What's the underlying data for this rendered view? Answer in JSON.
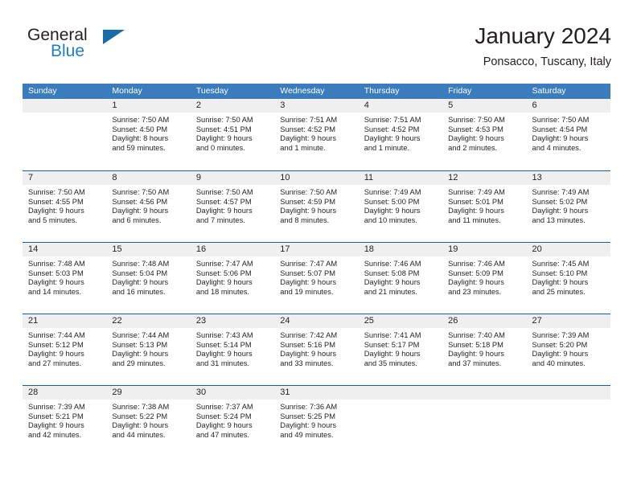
{
  "brand": {
    "word_one": "General",
    "word_two": "Blue",
    "logo_icon": "triangle-icon"
  },
  "header": {
    "title": "January 2024",
    "subtitle": "Ponsacco, Tuscany, Italy"
  },
  "colors": {
    "header_blue": "#3a7cbe",
    "row_divider_blue": "#1a5e9e",
    "day_band_gray": "#efefef",
    "brand_blue": "#1d7fc3",
    "text": "#231f20"
  },
  "weekdays": [
    "Sunday",
    "Monday",
    "Tuesday",
    "Wednesday",
    "Thursday",
    "Friday",
    "Saturday"
  ],
  "weeks": [
    [
      {
        "day": "",
        "lines": []
      },
      {
        "day": "1",
        "lines": [
          "Sunrise: 7:50 AM",
          "Sunset: 4:50 PM",
          "Daylight: 8 hours",
          "and 59 minutes."
        ]
      },
      {
        "day": "2",
        "lines": [
          "Sunrise: 7:50 AM",
          "Sunset: 4:51 PM",
          "Daylight: 9 hours",
          "and 0 minutes."
        ]
      },
      {
        "day": "3",
        "lines": [
          "Sunrise: 7:51 AM",
          "Sunset: 4:52 PM",
          "Daylight: 9 hours",
          "and 1 minute."
        ]
      },
      {
        "day": "4",
        "lines": [
          "Sunrise: 7:51 AM",
          "Sunset: 4:52 PM",
          "Daylight: 9 hours",
          "and 1 minute."
        ]
      },
      {
        "day": "5",
        "lines": [
          "Sunrise: 7:50 AM",
          "Sunset: 4:53 PM",
          "Daylight: 9 hours",
          "and 2 minutes."
        ]
      },
      {
        "day": "6",
        "lines": [
          "Sunrise: 7:50 AM",
          "Sunset: 4:54 PM",
          "Daylight: 9 hours",
          "and 4 minutes."
        ]
      }
    ],
    [
      {
        "day": "7",
        "lines": [
          "Sunrise: 7:50 AM",
          "Sunset: 4:55 PM",
          "Daylight: 9 hours",
          "and 5 minutes."
        ]
      },
      {
        "day": "8",
        "lines": [
          "Sunrise: 7:50 AM",
          "Sunset: 4:56 PM",
          "Daylight: 9 hours",
          "and 6 minutes."
        ]
      },
      {
        "day": "9",
        "lines": [
          "Sunrise: 7:50 AM",
          "Sunset: 4:57 PM",
          "Daylight: 9 hours",
          "and 7 minutes."
        ]
      },
      {
        "day": "10",
        "lines": [
          "Sunrise: 7:50 AM",
          "Sunset: 4:59 PM",
          "Daylight: 9 hours",
          "and 8 minutes."
        ]
      },
      {
        "day": "11",
        "lines": [
          "Sunrise: 7:49 AM",
          "Sunset: 5:00 PM",
          "Daylight: 9 hours",
          "and 10 minutes."
        ]
      },
      {
        "day": "12",
        "lines": [
          "Sunrise: 7:49 AM",
          "Sunset: 5:01 PM",
          "Daylight: 9 hours",
          "and 11 minutes."
        ]
      },
      {
        "day": "13",
        "lines": [
          "Sunrise: 7:49 AM",
          "Sunset: 5:02 PM",
          "Daylight: 9 hours",
          "and 13 minutes."
        ]
      }
    ],
    [
      {
        "day": "14",
        "lines": [
          "Sunrise: 7:48 AM",
          "Sunset: 5:03 PM",
          "Daylight: 9 hours",
          "and 14 minutes."
        ]
      },
      {
        "day": "15",
        "lines": [
          "Sunrise: 7:48 AM",
          "Sunset: 5:04 PM",
          "Daylight: 9 hours",
          "and 16 minutes."
        ]
      },
      {
        "day": "16",
        "lines": [
          "Sunrise: 7:47 AM",
          "Sunset: 5:06 PM",
          "Daylight: 9 hours",
          "and 18 minutes."
        ]
      },
      {
        "day": "17",
        "lines": [
          "Sunrise: 7:47 AM",
          "Sunset: 5:07 PM",
          "Daylight: 9 hours",
          "and 19 minutes."
        ]
      },
      {
        "day": "18",
        "lines": [
          "Sunrise: 7:46 AM",
          "Sunset: 5:08 PM",
          "Daylight: 9 hours",
          "and 21 minutes."
        ]
      },
      {
        "day": "19",
        "lines": [
          "Sunrise: 7:46 AM",
          "Sunset: 5:09 PM",
          "Daylight: 9 hours",
          "and 23 minutes."
        ]
      },
      {
        "day": "20",
        "lines": [
          "Sunrise: 7:45 AM",
          "Sunset: 5:10 PM",
          "Daylight: 9 hours",
          "and 25 minutes."
        ]
      }
    ],
    [
      {
        "day": "21",
        "lines": [
          "Sunrise: 7:44 AM",
          "Sunset: 5:12 PM",
          "Daylight: 9 hours",
          "and 27 minutes."
        ]
      },
      {
        "day": "22",
        "lines": [
          "Sunrise: 7:44 AM",
          "Sunset: 5:13 PM",
          "Daylight: 9 hours",
          "and 29 minutes."
        ]
      },
      {
        "day": "23",
        "lines": [
          "Sunrise: 7:43 AM",
          "Sunset: 5:14 PM",
          "Daylight: 9 hours",
          "and 31 minutes."
        ]
      },
      {
        "day": "24",
        "lines": [
          "Sunrise: 7:42 AM",
          "Sunset: 5:16 PM",
          "Daylight: 9 hours",
          "and 33 minutes."
        ]
      },
      {
        "day": "25",
        "lines": [
          "Sunrise: 7:41 AM",
          "Sunset: 5:17 PM",
          "Daylight: 9 hours",
          "and 35 minutes."
        ]
      },
      {
        "day": "26",
        "lines": [
          "Sunrise: 7:40 AM",
          "Sunset: 5:18 PM",
          "Daylight: 9 hours",
          "and 37 minutes."
        ]
      },
      {
        "day": "27",
        "lines": [
          "Sunrise: 7:39 AM",
          "Sunset: 5:20 PM",
          "Daylight: 9 hours",
          "and 40 minutes."
        ]
      }
    ],
    [
      {
        "day": "28",
        "lines": [
          "Sunrise: 7:39 AM",
          "Sunset: 5:21 PM",
          "Daylight: 9 hours",
          "and 42 minutes."
        ]
      },
      {
        "day": "29",
        "lines": [
          "Sunrise: 7:38 AM",
          "Sunset: 5:22 PM",
          "Daylight: 9 hours",
          "and 44 minutes."
        ]
      },
      {
        "day": "30",
        "lines": [
          "Sunrise: 7:37 AM",
          "Sunset: 5:24 PM",
          "Daylight: 9 hours",
          "and 47 minutes."
        ]
      },
      {
        "day": "31",
        "lines": [
          "Sunrise: 7:36 AM",
          "Sunset: 5:25 PM",
          "Daylight: 9 hours",
          "and 49 minutes."
        ]
      },
      {
        "day": "",
        "lines": []
      },
      {
        "day": "",
        "lines": []
      },
      {
        "day": "",
        "lines": []
      }
    ]
  ]
}
